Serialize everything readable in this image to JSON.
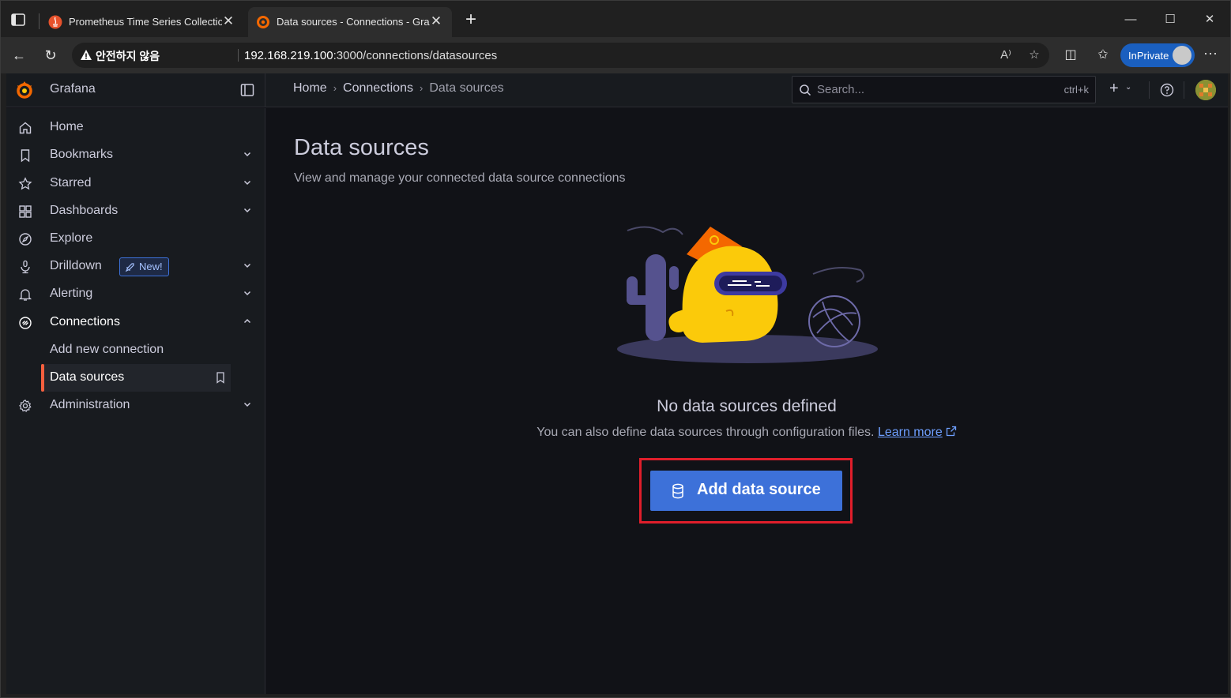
{
  "browser": {
    "tabs": [
      {
        "title": "Prometheus Time Series Collectio",
        "active": false
      },
      {
        "title": "Data sources - Connections - Gra",
        "active": true
      }
    ],
    "address": {
      "security_label": "안전하지 않음",
      "url_host": "192.168.219.100",
      "url_rest": ":3000/connections/datasources"
    },
    "profile_label": "InPrivate"
  },
  "grafana": {
    "brand": "Grafana",
    "breadcrumbs": [
      "Home",
      "Connections",
      "Data sources"
    ],
    "search": {
      "placeholder": "Search...",
      "shortcut": "ctrl+k"
    },
    "nav": {
      "home": "Home",
      "bookmarks": "Bookmarks",
      "starred": "Starred",
      "dashboards": "Dashboards",
      "explore": "Explore",
      "drilldown": "Drilldown",
      "drilldown_badge": "New!",
      "alerting": "Alerting",
      "connections": "Connections",
      "add_new_connection": "Add new connection",
      "data_sources": "Data sources",
      "administration": "Administration"
    }
  },
  "main": {
    "title": "Data sources",
    "subtitle": "View and manage your connected data source connections",
    "empty_title": "No data sources defined",
    "empty_text": "You can also define data sources through configuration files.",
    "learn_more": "Learn more",
    "add_button": "Add data source"
  },
  "colors": {
    "accent": "#3d71d9",
    "highlight_border": "#e01e2b",
    "active_bar": "#f55f3e"
  }
}
